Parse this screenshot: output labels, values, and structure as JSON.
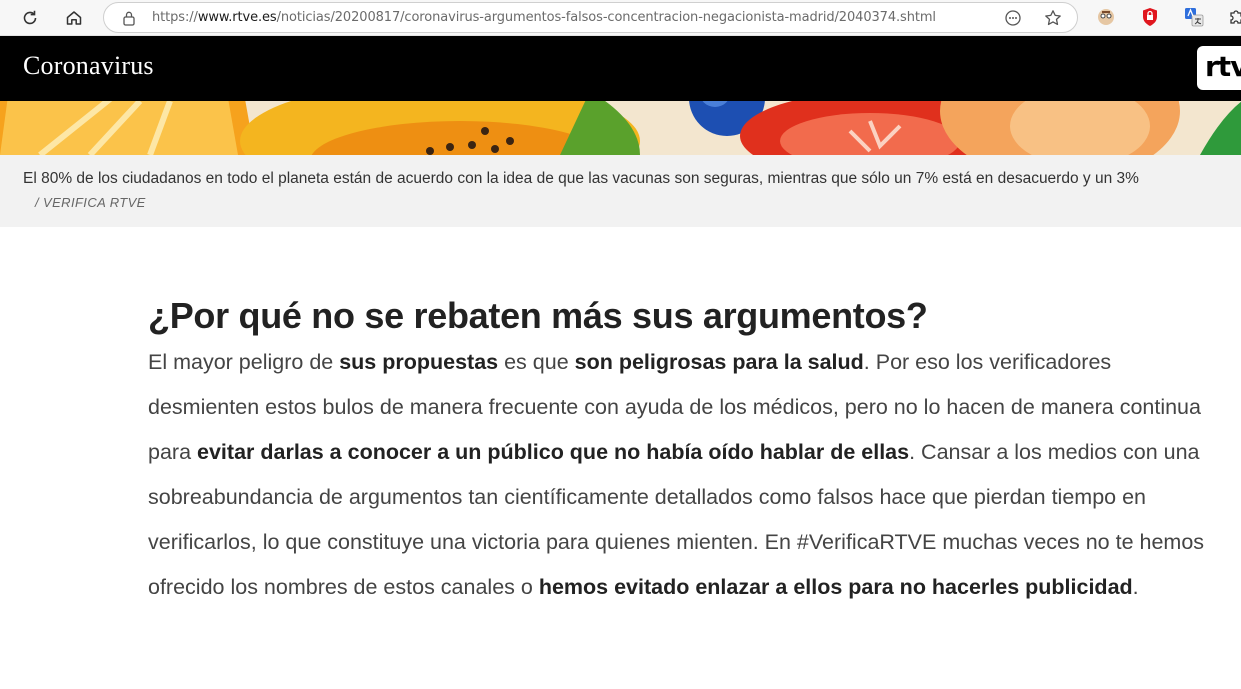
{
  "browser": {
    "url_prefix": "https://",
    "url_host": "www.rtve.es",
    "url_path": "/noticias/20200817/coronavirus-argumentos-falsos-concentracion-negacionista-madrid/2040374.shtml",
    "icons": [
      "refresh-icon",
      "home-icon",
      "lock-icon",
      "reader-icon",
      "star-icon",
      "extension-avatar-icon",
      "shield-extension-icon",
      "translate-extension-icon",
      "puzzle-extension-icon"
    ]
  },
  "header": {
    "section_title": "Coronavirus",
    "logo_text": "rtve"
  },
  "caption": {
    "text": "El 80% de los ciudadanos en todo el planeta están de acuerdo con la idea de que las vacunas son seguras, mientras que sólo un 7% está en desacuerdo y un 3%",
    "credit": "/ VERIFICA RTVE"
  },
  "article": {
    "heading": "¿Por qué no se rebaten más sus argumentos?",
    "paragraph": [
      {
        "text": "El mayor peligro de ",
        "bold": false
      },
      {
        "text": "sus propuestas",
        "bold": true
      },
      {
        "text": " es que ",
        "bold": false
      },
      {
        "text": "son peligrosas para la salud",
        "bold": true
      },
      {
        "text": ". Por eso los verificadores desmienten estos bulos de manera frecuente con ayuda de los médicos, pero no lo hacen de manera continua para ",
        "bold": false
      },
      {
        "text": "evitar darlas a conocer a un público que no había oído hablar de ellas",
        "bold": true
      },
      {
        "text": ". Cansar a los medios con una sobreabundancia de argumentos tan científicamente detallados como falsos hace que pierdan tiempo en verificarlos, lo que constituye una victoria para quienes mienten. En #VerificaRTVE muchas veces no te hemos ofrecido los nombres de estos canales o ",
        "bold": false
      },
      {
        "text": "hemos evitado enlazar a ellos para no hacerles publicidad",
        "bold": true
      },
      {
        "text": ".",
        "bold": false
      }
    ]
  },
  "colors": {
    "header_bg": "#000000",
    "caption_bg": "#f2f2f2",
    "heading_text": "#222222",
    "body_text": "#444444"
  }
}
